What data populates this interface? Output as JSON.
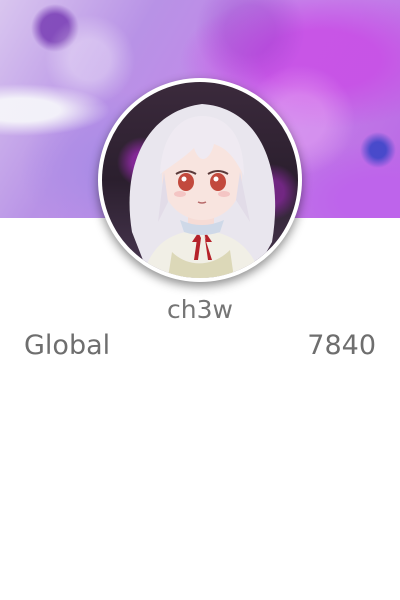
{
  "profile": {
    "username": "ch3w"
  },
  "stats": {
    "label": "Global",
    "value": "7840"
  },
  "colors": {
    "banner_primary": "#b967e4",
    "text_gray": "#757575",
    "background": "#ffffff"
  },
  "icons": {
    "avatar": "anime-girl-avatar-image",
    "banner": "purple-watercolor-banner-image"
  }
}
